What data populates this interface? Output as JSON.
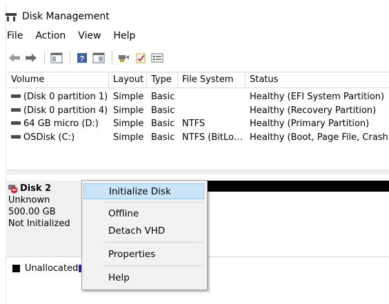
{
  "window": {
    "title": "Disk Management"
  },
  "menubar": {
    "items": [
      "File",
      "Action",
      "View",
      "Help"
    ]
  },
  "toolbar": {
    "icons": [
      "back-arrow-icon",
      "forward-arrow-icon",
      "console-tree-icon",
      "help-icon",
      "properties-icon",
      "rescan-icon",
      "check-icon",
      "refresh-icon"
    ]
  },
  "volumes": {
    "columns": [
      "Volume",
      "Layout",
      "Type",
      "File System",
      "Status"
    ],
    "rows": [
      {
        "volume": "(Disk 0 partition 1)",
        "layout": "Simple",
        "type": "Basic",
        "fs": "",
        "status": "Healthy (EFI System Partition)"
      },
      {
        "volume": "(Disk 0 partition 4)",
        "layout": "Simple",
        "type": "Basic",
        "fs": "",
        "status": "Healthy (Recovery Partition)"
      },
      {
        "volume": "64 GB micro (D:)",
        "layout": "Simple",
        "type": "Basic",
        "fs": "NTFS",
        "status": "Healthy (Primary Partition)"
      },
      {
        "volume": "OSDisk (C:)",
        "layout": "Simple",
        "type": "Basic",
        "fs": "NTFS (BitLo…",
        "status": "Healthy (Boot, Page File, Crash D"
      }
    ]
  },
  "disk": {
    "name": "Disk 2",
    "kind": "Unknown",
    "size": "500.00 GB",
    "state": "Not Initialized"
  },
  "legend": {
    "unallocated": "Unallocated"
  },
  "context_menu": {
    "items": [
      {
        "label": "Initialize Disk",
        "selected": true
      },
      {
        "label": "Offline"
      },
      {
        "label": "Detach VHD"
      },
      {
        "label": "Properties"
      },
      {
        "label": "Help"
      }
    ]
  },
  "colors": {
    "selection": "#cce4f7",
    "error_badge": "#d8232a"
  }
}
